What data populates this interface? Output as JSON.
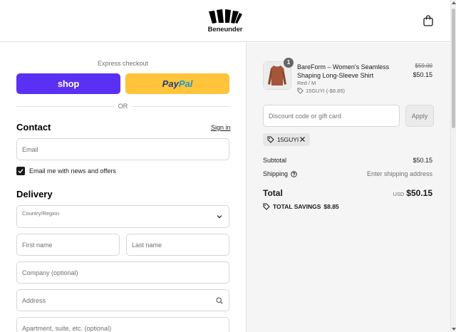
{
  "header": {
    "brand_name": "Beneunder"
  },
  "checkout": {
    "express_label": "Express checkout",
    "shop_label": "shop",
    "paypal_label_1": "Pay",
    "paypal_label_2": "Pal",
    "or_label": "OR",
    "contact_heading": "Contact",
    "signin_label": "Sign in",
    "email_placeholder": "Email",
    "newsletter_label": "Email me with news and offers",
    "newsletter_checked": true,
    "delivery_heading": "Delivery",
    "country_label": "Country/Region",
    "first_name_placeholder": "First name",
    "last_name_placeholder": "Last name",
    "company_placeholder": "Company (optional)",
    "address_placeholder": "Address",
    "apartment_placeholder": "Apartment, suite, etc. (optional)"
  },
  "summary": {
    "product": {
      "quantity": "1",
      "name": "BareForm – Women's Seamless Shaping Long-Sleeve Shirt",
      "variant": "Red / M",
      "discount": "15GUYI (-$8.85)",
      "original_price": "$59.00",
      "price": "$50.15",
      "image_color": "#a4553a"
    },
    "discount_placeholder": "Discount code or gift card",
    "apply_label": "Apply",
    "applied_code": "15GUYI",
    "subtotal_label": "Subtotal",
    "subtotal_value": "$50.15",
    "shipping_label": "Shipping",
    "shipping_value": "Enter shipping address",
    "total_label": "Total",
    "total_currency": "USD",
    "total_value": "$50.15",
    "savings_label": "TOTAL SAVINGS",
    "savings_value": "$8.85"
  },
  "colors": {
    "shop_purple": "#5a31f4",
    "paypal_yellow": "#ffc439",
    "summary_bg": "#f5f5f5"
  }
}
